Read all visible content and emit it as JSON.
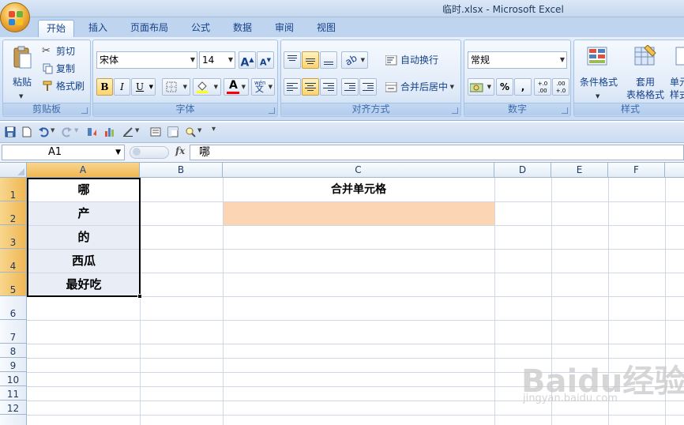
{
  "window": {
    "title": "临时.xlsx - Microsoft Excel"
  },
  "tabs": [
    {
      "label": "开始",
      "active": true
    },
    {
      "label": "插入"
    },
    {
      "label": "页面布局"
    },
    {
      "label": "公式"
    },
    {
      "label": "数据"
    },
    {
      "label": "审阅"
    },
    {
      "label": "视图"
    }
  ],
  "clipboard": {
    "paste": "粘贴",
    "cut": "剪切",
    "copy": "复制",
    "format_painter": "格式刷",
    "group": "剪贴板"
  },
  "font": {
    "name": "宋体",
    "size": "14",
    "grow": "A",
    "shrink": "A",
    "bold": "B",
    "italic": "I",
    "underline": "U",
    "font_color": "A",
    "phonetic": "wén",
    "phonetic_char": "文",
    "group": "字体"
  },
  "alignment": {
    "wrap": "自动换行",
    "merge": "合并后居中",
    "group": "对齐方式"
  },
  "number": {
    "format": "常规",
    "percent": "%",
    "comma": ",",
    "inc_decimal": "+.0 .00",
    "dec_decimal": ".00 +.0",
    "group": "数字"
  },
  "styles": {
    "conditional": "条件格式",
    "table_line1": "套用",
    "table_line2": "表格格式",
    "cell_line1": "单元",
    "cell_line2": "样式",
    "group": "样式"
  },
  "formula_bar": {
    "name_box": "A1",
    "fx": "fx",
    "value": "哪"
  },
  "columns": [
    "A",
    "B",
    "C",
    "D",
    "E",
    "F"
  ],
  "rows": [
    "1",
    "2",
    "3",
    "4",
    "5",
    "6",
    "7",
    "8",
    "9",
    "10",
    "11",
    "12"
  ],
  "cells": {
    "A1": "哪",
    "A2": "产",
    "A3": "的",
    "A4": "西瓜",
    "A5": "最好吃",
    "C1": "合并单元格"
  },
  "colors": {
    "selection_fill": "#e8edf6",
    "c2_fill": "#fcd5b4",
    "header_highlight": "#f5c56e"
  },
  "watermark": {
    "main": "Baidu经验",
    "sub": "jingyan.baidu.com"
  }
}
